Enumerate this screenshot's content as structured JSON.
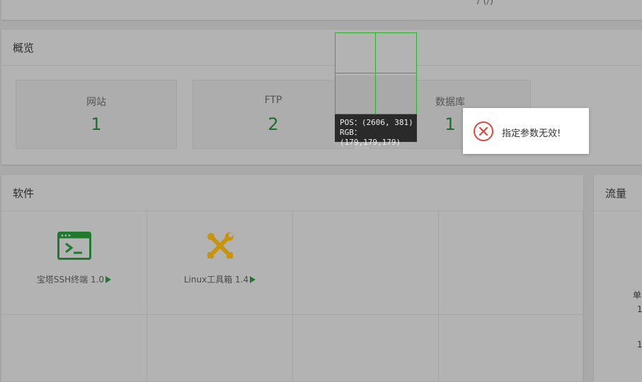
{
  "top_bar": {
    "fragment": "/ (/)"
  },
  "overview": {
    "title": "概览",
    "cards": [
      {
        "label": "网站",
        "value": "1"
      },
      {
        "label": "FTP",
        "value": "2"
      },
      {
        "label": "数据库",
        "value": "1"
      }
    ]
  },
  "software": {
    "title": "软件",
    "items": [
      {
        "name": "宝塔SSH终端 1.0",
        "icon": "terminal-icon",
        "color": "#1f7a2e"
      },
      {
        "name": "Linux工具箱 1.4",
        "icon": "tools-icon",
        "color": "#c8940b"
      }
    ]
  },
  "traffic": {
    "title": "流量",
    "frag_unit": "单",
    "frag_1": "1",
    "frag_2": "1"
  },
  "picker": {
    "pos": "POS：(2606, 381)",
    "rgb": "RGB：(179,179,179)"
  },
  "toast": {
    "message": "指定参数无效!",
    "icon": "error-circle-icon",
    "color": "#e0483d"
  }
}
